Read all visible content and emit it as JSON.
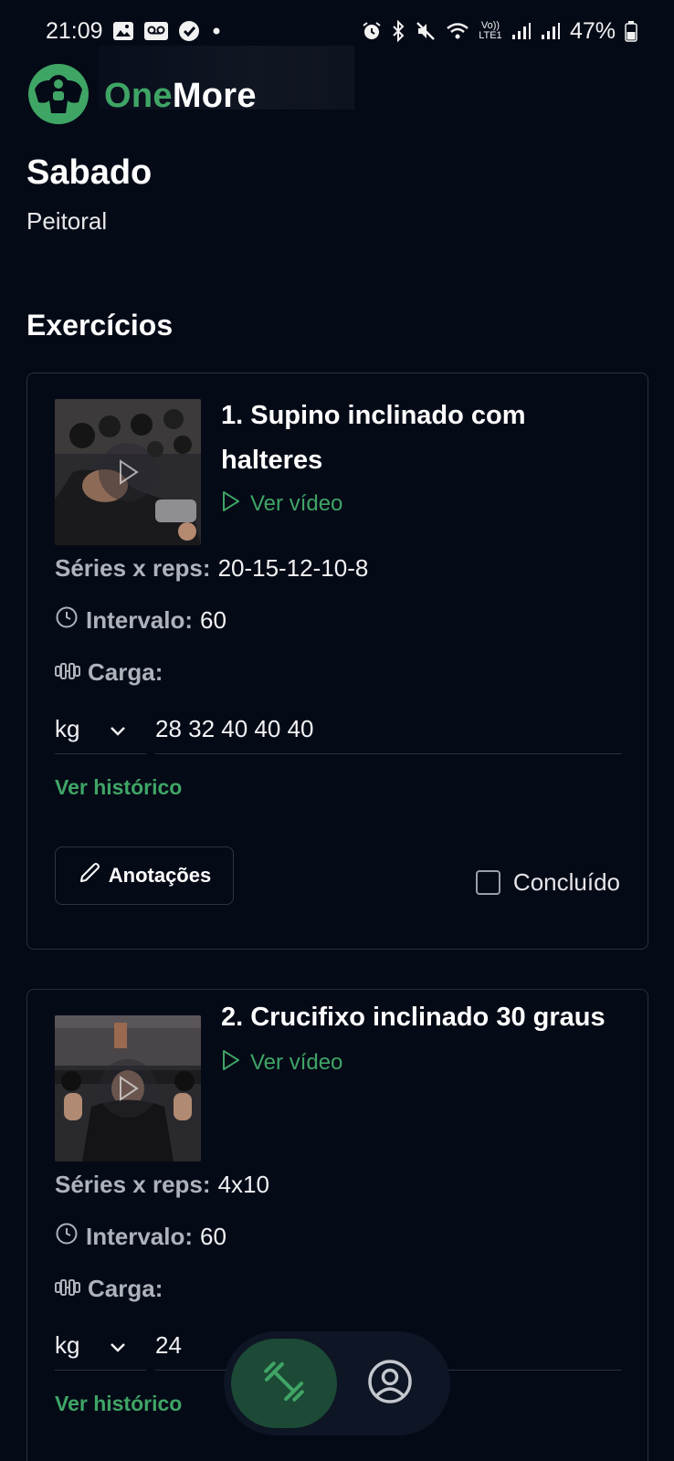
{
  "status_bar": {
    "time": "21:09",
    "battery": "47%",
    "volte_text": "Vo)) LTE1"
  },
  "header": {
    "brand_part1": "One",
    "brand_part2": "More"
  },
  "day": {
    "title": "Sabado",
    "subtitle": "Peitoral"
  },
  "section": {
    "title": "Exercícios"
  },
  "exercises": [
    {
      "title": "1. Supino inclinado com halteres",
      "video_label": "Ver vídeo",
      "sets_label": "Séries x reps:",
      "sets_value": "20-15-12-10-8",
      "interval_label": "Intervalo:",
      "interval_value": "60",
      "load_label": "Carga:",
      "unit": "kg",
      "load_value": "28 32 40 40 40",
      "history_label": "Ver histórico",
      "notes_label": "Anotações",
      "done_label": "Concluído",
      "done_checked": false
    },
    {
      "title": "2. Crucifixo inclinado 30 graus",
      "video_label": "Ver vídeo",
      "sets_label": "Séries x reps:",
      "sets_value": "4x10",
      "interval_label": "Intervalo:",
      "interval_value": "60",
      "load_label": "Carga:",
      "unit": "kg",
      "load_value": "24",
      "history_label": "Ver histórico"
    }
  ],
  "bottom_nav": {
    "items": [
      {
        "icon": "dumbbell-icon",
        "active": true
      },
      {
        "icon": "user-profile-icon",
        "active": false
      }
    ]
  },
  "colors": {
    "background": "#050a17",
    "accent": "#3fa565",
    "card_border": "#273040",
    "nav_active": "#1c4a36"
  }
}
